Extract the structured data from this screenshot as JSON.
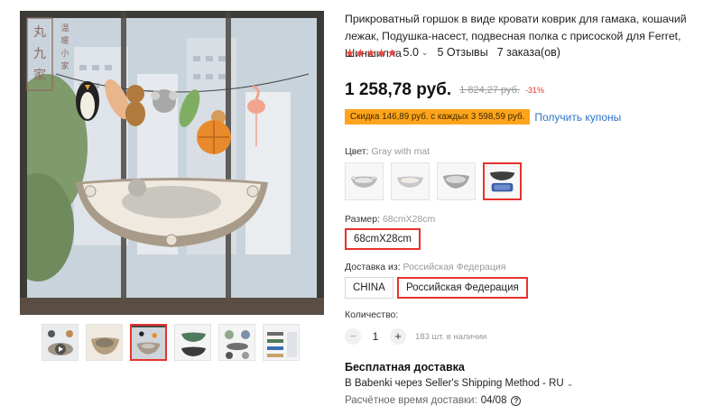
{
  "product": {
    "title": "Прикроватный горшок в виде кровати коврик для гамака, кошачий лежак, Подушка-насест, подвесная полка с присоской для Ferret, Шиншилла",
    "rating": "5.0",
    "rating_stars": 5,
    "reviews": "5 Отзывы",
    "orders": "7 заказа(ов)",
    "price": "1 258,78 руб.",
    "old_price": "1 824,27 руб.",
    "discount": "-31%",
    "coupon_text": "Скидка 146,89 руб. с каждых 3 598,59 руб.",
    "coupon_link": "Получить купоны"
  },
  "gallery": {
    "seal_text": "九 家",
    "seal_side_text": "温 暖 小 家",
    "thumbnail_count": 6,
    "selected_thumbnail": 3
  },
  "color": {
    "label": "Цвет:",
    "value": "Gray with mat",
    "options_count": 4,
    "selected_index": 4
  },
  "size": {
    "label": "Размер:",
    "value": "68cmX28cm",
    "options": [
      "68cmX28cm"
    ]
  },
  "ship_from": {
    "label": "Доставка из:",
    "value": "Российская Федерация",
    "options": [
      "CHINA",
      "Российская Федерация"
    ]
  },
  "quantity": {
    "label": "Количество:",
    "minus": "−",
    "plus": "+",
    "value": "1",
    "stock": "183 шт. в наличии"
  },
  "shipping": {
    "title": "Бесплатная доставка",
    "method": "В Babenki через Seller's Shipping Method - RU",
    "time_label": "Расчётное время доставки:",
    "date": "04/08",
    "help": "?"
  },
  "icons": {
    "star": "star-icon",
    "chevron": "chevron-down-icon",
    "help": "help-circle-icon"
  },
  "colors": {
    "accent": "#e8322e",
    "coupon_bg": "#ffa41c",
    "link": "#2d74c9",
    "stars": "#f0453e"
  }
}
